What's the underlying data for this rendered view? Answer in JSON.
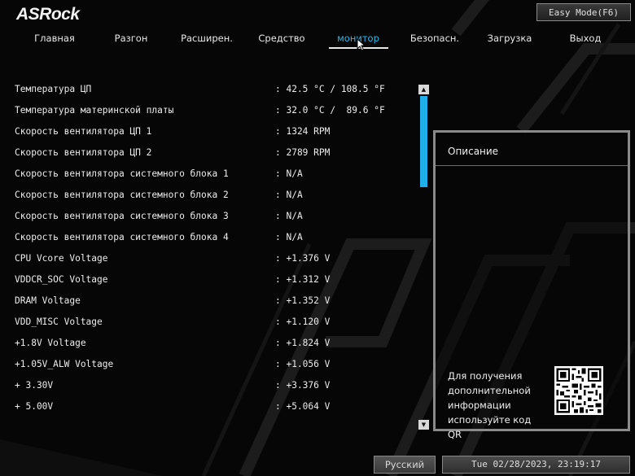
{
  "brand": {
    "logo": "ASRock"
  },
  "easy_mode_button": "Easy Mode(F6)",
  "tabs": [
    {
      "label": "Главная"
    },
    {
      "label": "Разгон"
    },
    {
      "label": "Расширен."
    },
    {
      "label": "Средство"
    },
    {
      "label": "монитор",
      "active": true
    },
    {
      "label": "Безопасн."
    },
    {
      "label": "Загрузка"
    },
    {
      "label": "Выход"
    }
  ],
  "monitor": {
    "rows": [
      {
        "label": "Температура ЦП",
        "value": ": 42.5 °C / 108.5 °F"
      },
      {
        "label": "Температура материнской платы",
        "value": ": 32.0 °C /  89.6 °F"
      },
      {
        "label": "Скорость вентилятора ЦП 1",
        "value": ": 1324 RPM"
      },
      {
        "label": "Скорость вентилятора ЦП 2",
        "value": ": 2789 RPM"
      },
      {
        "label": "Скорость вентилятора системного блока 1",
        "value": ": N/A"
      },
      {
        "label": "Скорость вентилятора системного блока 2",
        "value": ": N/A"
      },
      {
        "label": "Скорость вентилятора системного блока 3",
        "value": ": N/A"
      },
      {
        "label": "Скорость вентилятора системного блока 4",
        "value": ": N/A"
      },
      {
        "label": "CPU Vcore Voltage",
        "value": ": +1.376 V"
      },
      {
        "label": "VDDCR_SOC Voltage",
        "value": ": +1.312 V"
      },
      {
        "label": "DRAM Voltage",
        "value": ": +1.352 V"
      },
      {
        "label": "VDD_MISC Voltage",
        "value": ": +1.120 V"
      },
      {
        "label": "+1.8V Voltage",
        "value": ": +1.824 V"
      },
      {
        "label": "+1.05V_ALW Voltage",
        "value": ": +1.056 V"
      },
      {
        "label": "+ 3.30V",
        "value": ": +3.376 V"
      },
      {
        "label": "+ 5.00V",
        "value": ": +5.064 V"
      }
    ]
  },
  "description": {
    "title": "Описание",
    "help_text": "Для получения дополнительной информации используйте код QR"
  },
  "footer": {
    "language": "Русский",
    "datetime": "Tue 02/28/2023, 23:19:17"
  },
  "colors": {
    "accent": "#1fb0ec",
    "background": "#060606"
  }
}
